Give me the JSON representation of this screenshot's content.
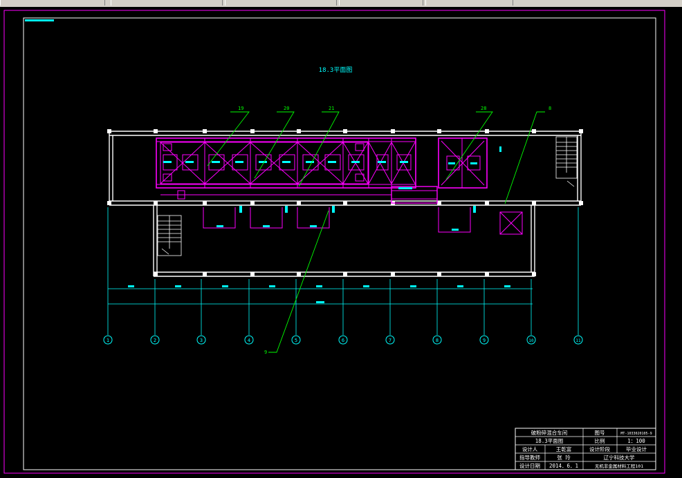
{
  "drawing": {
    "plan_title": "18.3平面图",
    "leaders": [
      "19",
      "20",
      "21",
      "28",
      "8",
      "9"
    ],
    "axis_labels": [
      "1",
      "2",
      "3",
      "4",
      "5",
      "6",
      "7",
      "8",
      "9",
      "10",
      "11"
    ]
  },
  "title_block": {
    "project": "破粉碎混合车间",
    "sheet_name": "18.3平面图",
    "lbl_drawing_no": "图号",
    "drawing_no": "MT-1033020105-9",
    "lbl_scale": "比例",
    "scale": "1：100",
    "lbl_designer": "设计人",
    "designer": "王乾富",
    "lbl_stage": "设计阶段",
    "stage": "毕业设计",
    "lbl_advisor": "指导教师",
    "advisor": "张 玲",
    "school": "辽宁科技大学",
    "lbl_date": "设计日期",
    "date": "2014．6．1",
    "class": "无机非金属材料工程101"
  },
  "colors": {
    "frame": "#ff00ff",
    "walls": "#ffffff",
    "equipment": "#ff00ff",
    "leaders": "#00ff00",
    "dims": "#00ffff"
  }
}
